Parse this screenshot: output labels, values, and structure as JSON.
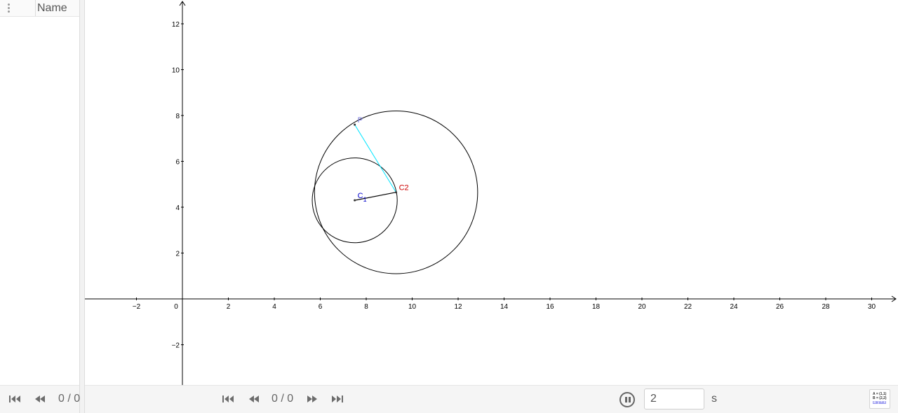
{
  "algebra_panel": {
    "column_header": "Name",
    "counter": "0 / 0"
  },
  "graphics": {
    "x_ticks": [
      "−2",
      "0",
      "2",
      "4",
      "6",
      "8",
      "10",
      "12",
      "14",
      "16",
      "18",
      "20",
      "22",
      "24",
      "26",
      "28",
      "30"
    ],
    "y_ticks": [
      "12",
      "10",
      "8",
      "6",
      "4",
      "2",
      "−2"
    ],
    "points": [
      {
        "label": "P",
        "x": 7.5,
        "y": 7.6,
        "color": "#7777dd"
      },
      {
        "label": "C",
        "subscript": "1",
        "x": 7.5,
        "y": 4.3,
        "color": "#0000cc"
      },
      {
        "label": "C2",
        "x": 9.3,
        "y": 4.65,
        "color": "#cc0000"
      }
    ],
    "circles": [
      {
        "cx": 7.5,
        "cy": 4.3,
        "r": 1.85
      },
      {
        "cx": 9.3,
        "cy": 4.65,
        "r": 3.55
      }
    ],
    "segment_color": "#00e5ff"
  },
  "toolbar": {
    "counter": "0 / 0",
    "speed_value": "2",
    "speed_unit": "s"
  },
  "algebra_icon_lines": [
    "A = (1,1)",
    "B = (2,2)",
    "a: y = x"
  ]
}
